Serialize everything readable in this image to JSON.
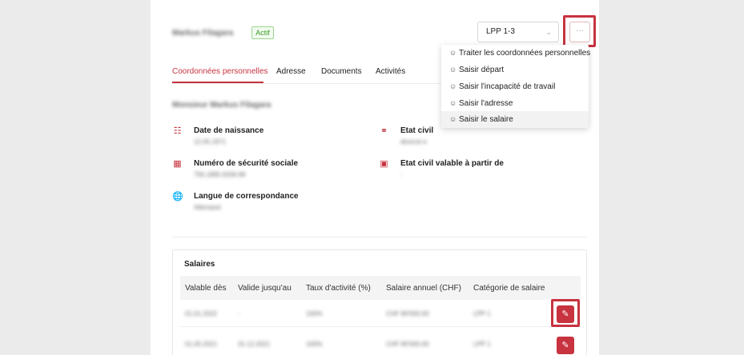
{
  "header": {
    "name": "Markus Filagara",
    "status": "Actif",
    "contract_select": "LPP 1-3",
    "more_label": "···"
  },
  "tabs": [
    {
      "label": "Coordonnées personnelles",
      "active": true
    },
    {
      "label": "Adresse"
    },
    {
      "label": "Documents"
    },
    {
      "label": "Activités"
    }
  ],
  "person": {
    "full_name": "Monsieur Markus Filagara"
  },
  "fields": {
    "birth": {
      "label": "Date de naissance",
      "value": "12.05.1971"
    },
    "civil": {
      "label": "Etat civil",
      "value": "divorcé·e"
    },
    "avs": {
      "label": "Numéro de sécurité sociale",
      "value": "756.1895.6336.99"
    },
    "civil_since": {
      "label": "Etat civil valable à partir de",
      "value": "-"
    },
    "lang": {
      "label": "Langue de correspondance",
      "value": "Allemand"
    }
  },
  "menu": {
    "items": [
      "Traiter les coordonnées personnelles",
      "Saisir départ",
      "Saisir l'incapacité de travail",
      "Saisir l'adresse",
      "Saisir le salaire"
    ]
  },
  "salaries": {
    "title": "Salaires",
    "columns": [
      "Valable dès",
      "Valide jusqu'au",
      "Taux d'activité (%)",
      "Salaire annuel (CHF)",
      "Catégorie de salaire"
    ],
    "rows": [
      [
        "01.01.2022",
        "-",
        "100%",
        "CHF 80'000.00",
        "LPP 1"
      ],
      [
        "01.05.2021",
        "31.12.2021",
        "100%",
        "CHF 80'000.00",
        "LPP 1"
      ]
    ]
  },
  "colors": {
    "accent": "#c7333f",
    "active_badge": "#3b9b2a"
  }
}
